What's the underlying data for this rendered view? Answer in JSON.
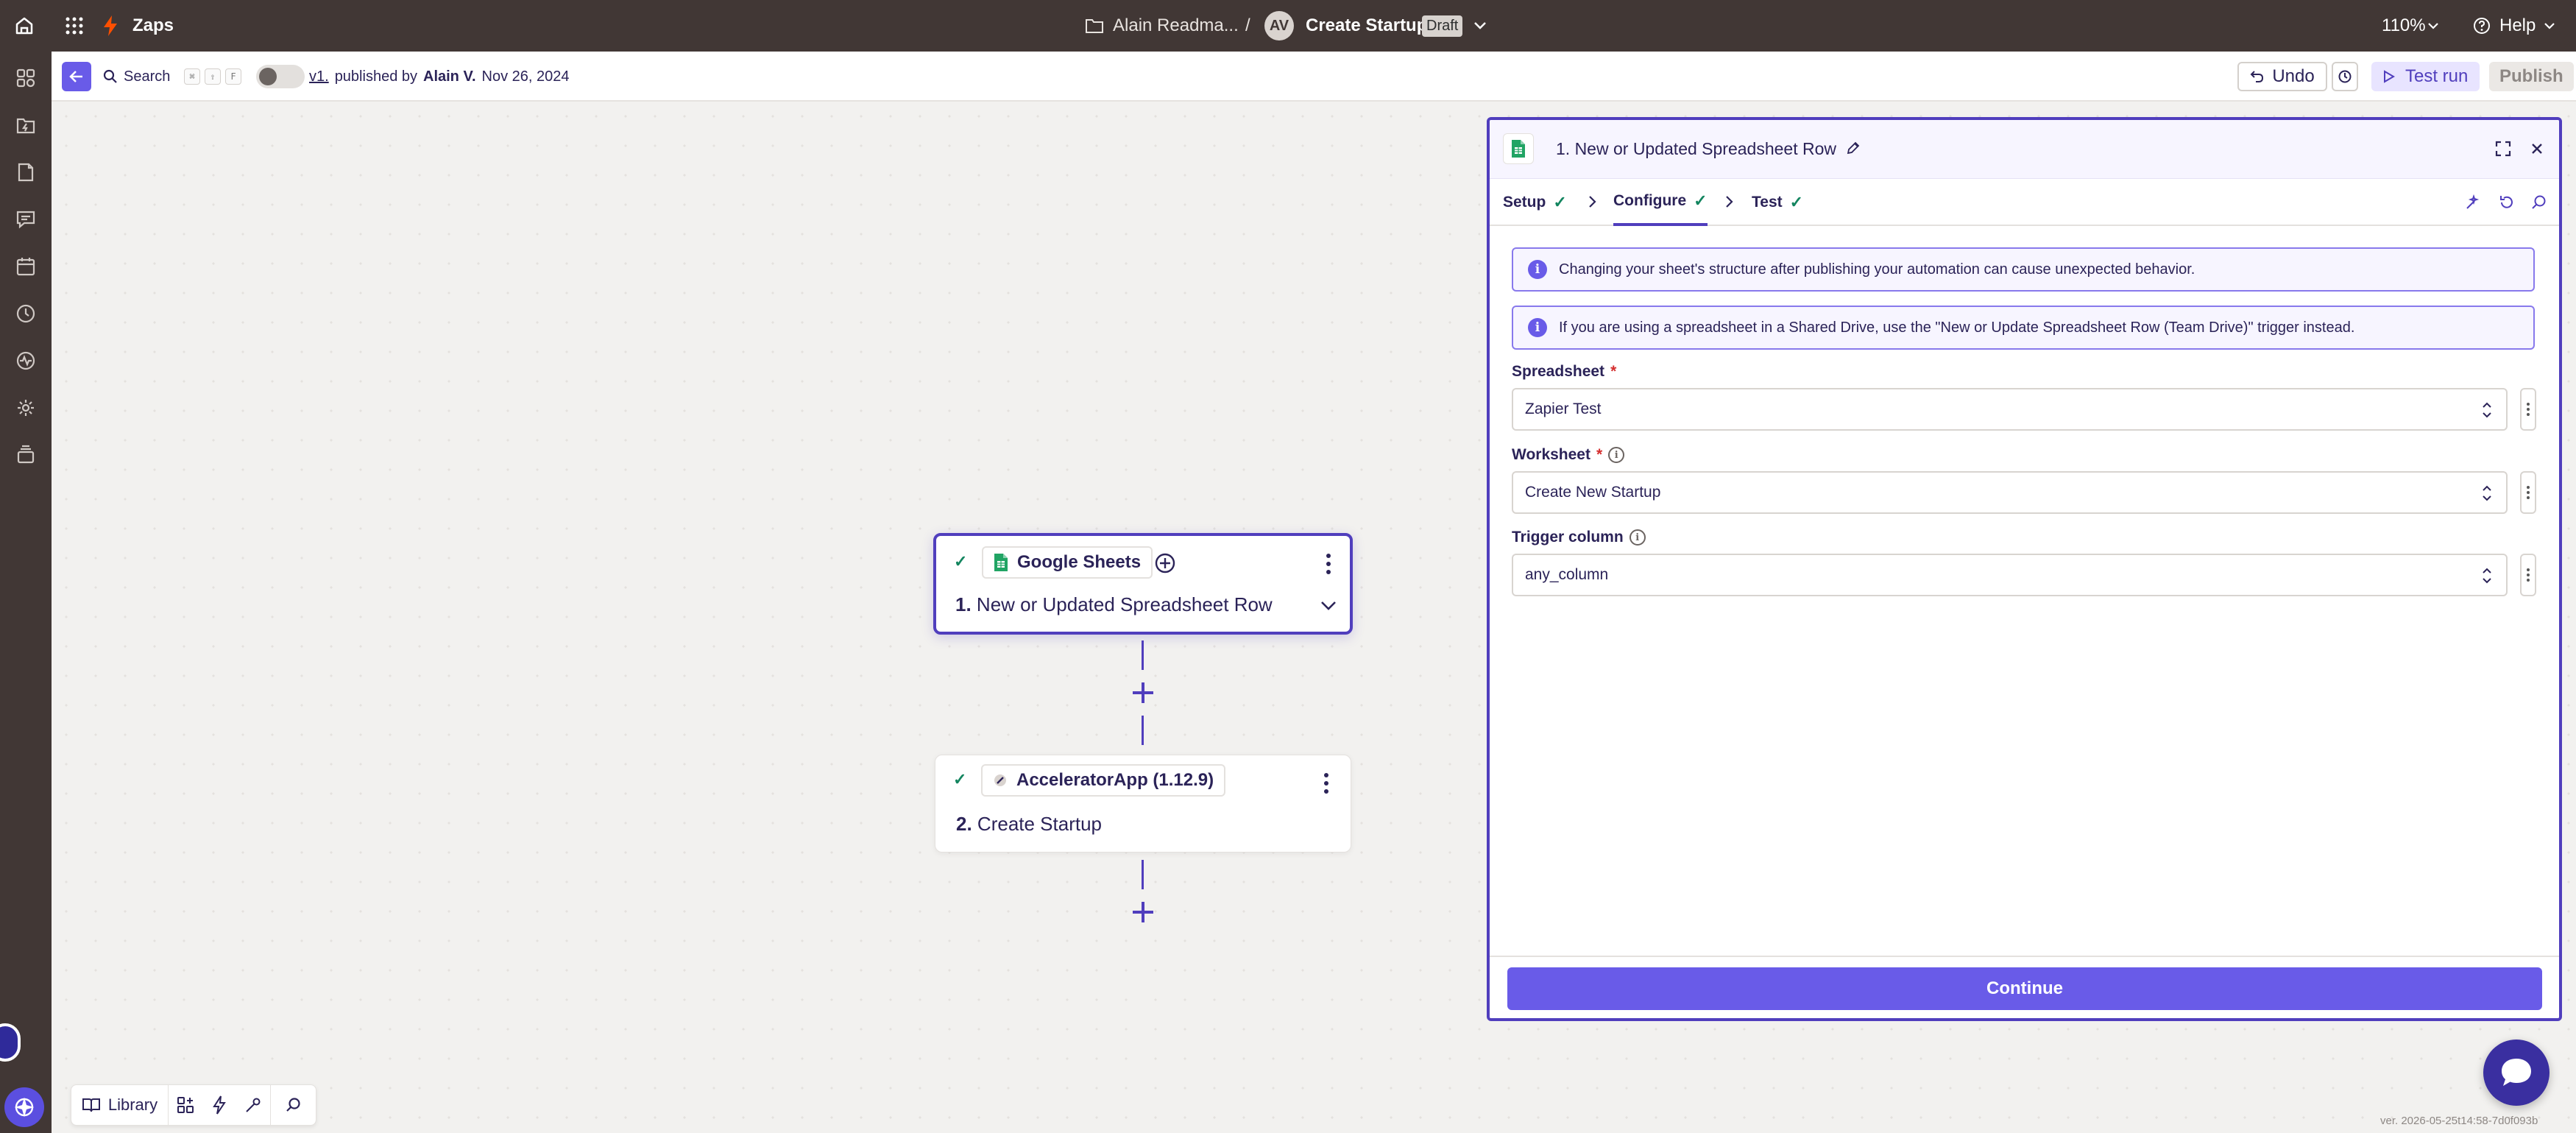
{
  "topbar": {
    "app_name": "Zaps",
    "folder": "Alain Readma...",
    "separator": "/",
    "avatar_initials": "AV",
    "zap_title": "Create Startup",
    "status_badge": "Draft",
    "zoom": "110%",
    "help": "Help"
  },
  "toolbar": {
    "search_label": "Search",
    "shortcut_keys": [
      "⌘",
      "⇧",
      "F"
    ],
    "version_link": "v1.",
    "published_by_text": "published by",
    "publisher": "Alain V.",
    "published_date": "Nov 26, 2024",
    "undo_label": "Undo",
    "test_run_label": "Test run",
    "publish_label": "Publish"
  },
  "canvas": {
    "steps": [
      {
        "app": "Google Sheets",
        "number": "1.",
        "title": "New or Updated Spreadsheet Row"
      },
      {
        "app": "AcceleratorApp (1.12.9)",
        "number": "2.",
        "title": "Create Startup"
      }
    ]
  },
  "panel": {
    "title": "1. New or Updated Spreadsheet Row",
    "tabs": [
      {
        "label": "Setup",
        "complete": true
      },
      {
        "label": "Configure",
        "complete": true,
        "active": true
      },
      {
        "label": "Test",
        "complete": true
      }
    ],
    "info_messages": [
      "Changing your sheet's structure after publishing your automation can cause unexpected behavior.",
      "If you are using a spreadsheet in a Shared Drive, use the \"New or Update Spreadsheet Row (Team Drive)\" trigger instead."
    ],
    "fields": [
      {
        "label": "Spreadsheet",
        "required_mark": "*",
        "value": "Zapier Test"
      },
      {
        "label": "Worksheet",
        "required_mark": "*",
        "value": "Create New Startup"
      },
      {
        "label": "Trigger column",
        "value": "any_column"
      }
    ],
    "continue_label": "Continue"
  },
  "bottom_bar": {
    "library_label": "Library"
  },
  "version_text": "ver. 2026-05-25t14:58-7d0f093b",
  "colors": {
    "accent": "#695be8",
    "accent_dark": "#503ebd",
    "topbar": "#413735",
    "success": "#13855f",
    "zap_orange": "#ff4f00"
  }
}
